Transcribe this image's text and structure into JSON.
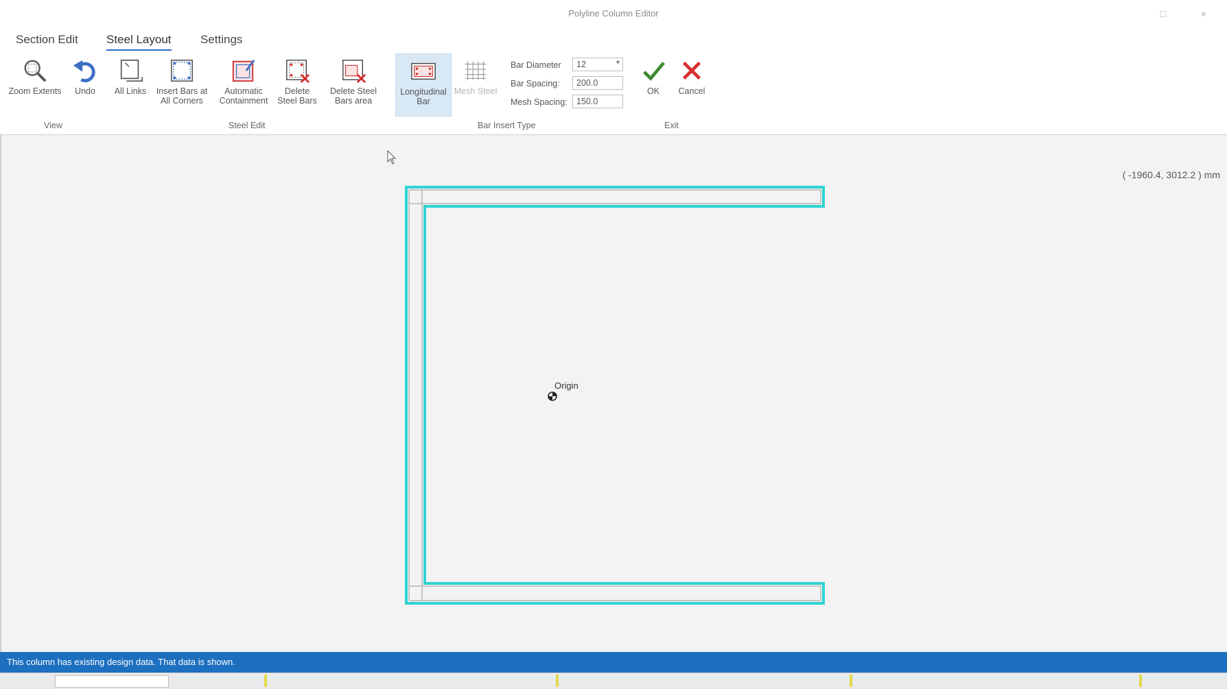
{
  "window": {
    "title": "Polyline Column Editor",
    "maximize_glyph": "□",
    "close_glyph": "×"
  },
  "tabs": [
    {
      "label": "Section Edit",
      "active": false
    },
    {
      "label": "Steel Layout",
      "active": true
    },
    {
      "label": "Settings",
      "active": false
    }
  ],
  "ribbon": {
    "groups": {
      "view": "View",
      "steel_edit": "Steel Edit",
      "bar_insert_type": "Bar Insert Type",
      "exit": "Exit"
    },
    "buttons": {
      "zoom_extents": "Zoom Extents",
      "undo": "Undo",
      "all_links": "All Links",
      "insert_bars_line1": "Insert Bars at",
      "insert_bars_line2": "All Corners",
      "auto_contain_line1": "Automatic",
      "auto_contain_line2": "Containment",
      "delete_steel_line1": "Delete",
      "delete_steel_line2": "Steel Bars",
      "delete_steel_area_line1": "Delete Steel",
      "delete_steel_area_line2": "Bars area",
      "longitudinal_line1": "Longitudinal",
      "longitudinal_line2": "Bar",
      "mesh_steel": "Mesh Steel",
      "ok": "OK",
      "cancel": "Cancel"
    },
    "fields": {
      "bar_diameter_label": "Bar Diameter",
      "bar_diameter_value": "12",
      "bar_spacing_label": "Bar Spacing:",
      "bar_spacing_value": "200.0",
      "mesh_spacing_label": "Mesh Spacing:",
      "mesh_spacing_value": "150.0"
    },
    "colors": {
      "selected_bg": "#d9e8f5",
      "ok_green": "#3c8a2e",
      "cancel_red": "#d83030"
    }
  },
  "canvas": {
    "coordinate_readout": "( -1960.4, 3012.2 ) mm",
    "origin_label": "Origin",
    "section_outline_color": "#2ed3d3"
  },
  "status": {
    "message": "This column has existing design data. That data is shown."
  }
}
